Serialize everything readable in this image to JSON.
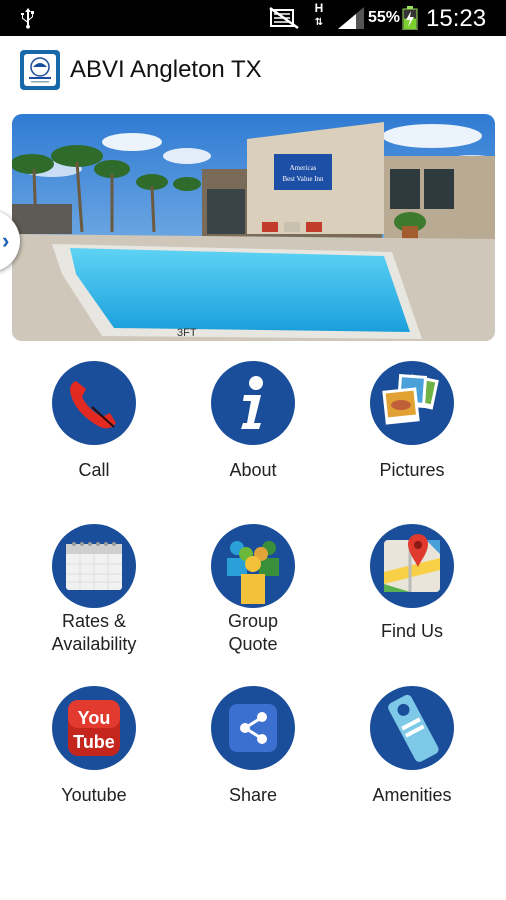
{
  "status_bar": {
    "usb_icon": "usb-icon",
    "network_type": "H",
    "battery_percent": "55%",
    "battery_level": 0.55,
    "time": "15:23"
  },
  "app_bar": {
    "title": "ABVI Angleton TX",
    "logo_icon": "hotel-logo-icon"
  },
  "hero": {
    "image": "pool-and-hotel-photo",
    "colors": {
      "sky": "#4a8ed6",
      "pool": "#34b4e6",
      "building": "#d8cdb8"
    }
  },
  "menu": {
    "items": [
      {
        "id": "call",
        "label": "Call",
        "icon": "phone-icon"
      },
      {
        "id": "about",
        "label": "About",
        "icon": "info-icon"
      },
      {
        "id": "pictures",
        "label": "Pictures",
        "icon": "photos-icon"
      },
      {
        "id": "rates",
        "label": "Rates &\nAvailability",
        "icon": "calendar-icon"
      },
      {
        "id": "group",
        "label": "Group\nQuote",
        "icon": "group-icon"
      },
      {
        "id": "findus",
        "label": "Find Us",
        "icon": "map-icon"
      },
      {
        "id": "youtube",
        "label": "Youtube",
        "icon": "youtube-icon"
      },
      {
        "id": "share",
        "label": "Share",
        "icon": "share-icon"
      },
      {
        "id": "amenities",
        "label": "Amenities",
        "icon": "door-hanger-icon"
      }
    ]
  },
  "theme": {
    "icon_circle": "#1a4e9a",
    "accent": "#1d62b5"
  }
}
